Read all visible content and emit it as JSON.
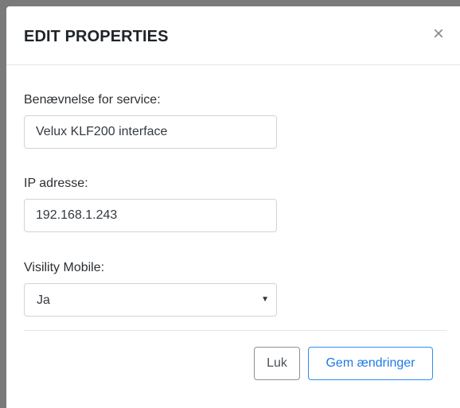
{
  "dialog": {
    "title": "EDIT PROPERTIES",
    "close_symbol": "×"
  },
  "form": {
    "service_name": {
      "label": "Benævnelse for service:",
      "value": "Velux KLF200 interface"
    },
    "ip_address": {
      "label": "IP adresse:",
      "value": "192.168.1.243"
    },
    "visibility_mobile": {
      "label": "Visility Mobile:",
      "selected": "Ja",
      "caret": "▼"
    }
  },
  "footer": {
    "close_label": "Luk",
    "save_label": "Gem ændringer"
  },
  "icons": {
    "close": "close-icon",
    "dropdown": "chevron-down-icon"
  },
  "colors": {
    "primary": "#1f7ae6",
    "primary_border": "#2f8cf2",
    "secondary_border": "#8c9196",
    "divider": "#e3e6ea"
  }
}
